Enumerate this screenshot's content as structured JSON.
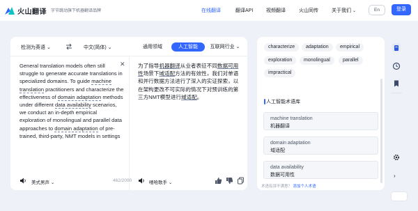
{
  "header": {
    "brand": "火山翻译",
    "tagline": "字节跳动旗下机器翻译品牌",
    "nav": [
      {
        "label": "在线翻译",
        "active": true
      },
      {
        "label": "翻译API",
        "active": false
      },
      {
        "label": "视频翻译",
        "active": false
      },
      {
        "label": "火山同传",
        "active": false
      },
      {
        "label": "关于我们",
        "active": false,
        "has_dropdown": true
      }
    ],
    "lang_toggle": "En",
    "login_label": "登录"
  },
  "translator": {
    "source_lang": "检测为英语",
    "target_lang": "中文(简体)",
    "domains": [
      {
        "label": "通用领域",
        "active": false
      },
      {
        "label": "人工智能",
        "active": true
      },
      {
        "label": "互联网行业",
        "active": false
      }
    ],
    "source_segments": [
      {
        "text": "General translation models often still struggle to generate accurate translations in specialized domains. To guide ",
        "term": false
      },
      {
        "text": "machine translation",
        "term": true
      },
      {
        "text": " practitioners and characterize the effectiveness of ",
        "term": false
      },
      {
        "text": "domain adaptation",
        "term": true
      },
      {
        "text": " methods under different ",
        "term": false
      },
      {
        "text": "data availability",
        "term": true
      },
      {
        "text": " scenarios, we conduct an in-depth empirical exploration of monolingual and parallel data approaches to ",
        "term": false
      },
      {
        "text": "domain adaptation",
        "term": true
      },
      {
        "text": " of pre-trained, third-party, NMT models in settings",
        "term": false
      }
    ],
    "target_segments": [
      {
        "text": "为了指导",
        "term": false
      },
      {
        "text": "机器翻译",
        "term": true
      },
      {
        "text": "从业者表征不同",
        "term": false
      },
      {
        "text": "数据可用性",
        "term": true
      },
      {
        "text": "场景下",
        "term": false
      },
      {
        "text": "域适配",
        "term": true
      },
      {
        "text": "方法的有效性，我们对单语和并行数据方法进行了深入的实证探索，以在架构更改不可实际的情况下对预训练的第三方NMT模型进行",
        "term": false
      },
      {
        "text": "域适配",
        "term": true
      },
      {
        "text": "。",
        "term": false
      }
    ],
    "source_voice": "美式男声",
    "char_count": "462/2000",
    "target_voice": "嘻哈歌手"
  },
  "terms": {
    "chips": [
      "characterize",
      "adaptation",
      "empirical",
      "exploration",
      "monolingual",
      "parallel",
      "impractical"
    ],
    "section_title": "人工智能术语库",
    "entries": [
      {
        "en": "machine translation",
        "zh": "机器翻译"
      },
      {
        "en": "domain adaptation",
        "zh": "域适配"
      },
      {
        "en": "data availability",
        "zh": "数据可用性"
      }
    ],
    "feedback_text": "术语有误不满意？",
    "feedback_link": "添加个人术语"
  },
  "colors": {
    "accent": "#3266fd",
    "background": "#eef1f7",
    "panel": "#ffffff"
  }
}
